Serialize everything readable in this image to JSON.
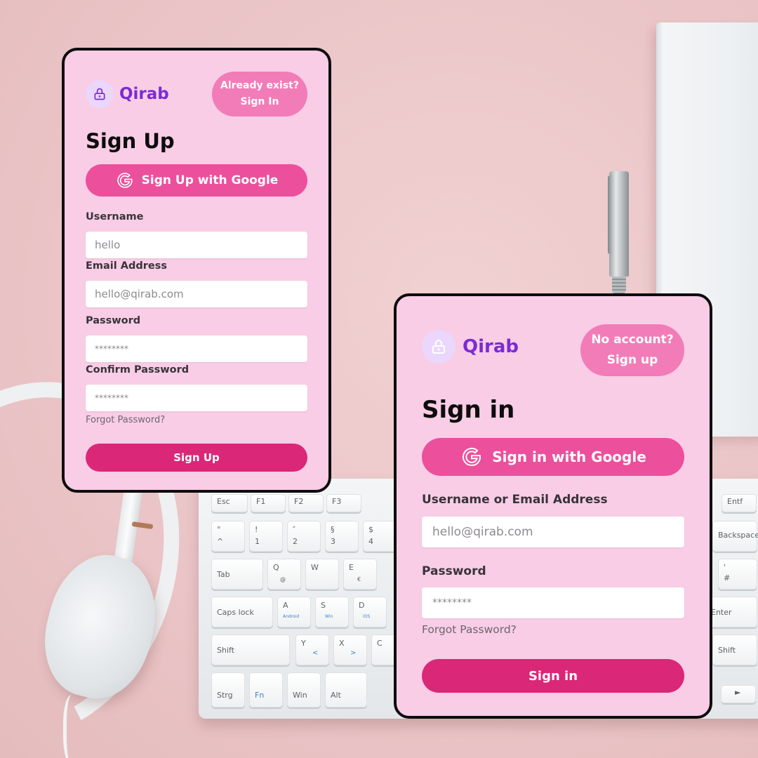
{
  "colors": {
    "card_bg": "#f9cde6",
    "brand_purple": "#7b2bd3",
    "pill_pink": "#f27cb8",
    "google_pink": "#ec4f9c",
    "submit_pink": "#db2777",
    "border": "#0d0d0d"
  },
  "background": {
    "keyboard_keys": {
      "esc": "Esc",
      "f1": "F1",
      "f2": "F2",
      "f3": "F3",
      "n0": "°",
      "n0b": "^",
      "n1": "!",
      "n1b": "1",
      "n2": "″",
      "n2b": "2",
      "n3": "§",
      "n3b": "3",
      "n4": "$",
      "n4b": "4",
      "tab": "Tab",
      "q": "Q",
      "q_sub": "@",
      "w": "W",
      "e": "E",
      "e_sub": "€",
      "caps": "Caps lock",
      "a": "A",
      "a_sub": "Android",
      "s": "S",
      "s_sub": "Win",
      "d": "D",
      "d_sub": "iOS",
      "shift_l": "Shift",
      "y": "Y",
      "y_sub": "<",
      "x": "X",
      "x_sub": ">",
      "c": "C",
      "strg": "Strg",
      "fn": "Fn",
      "win": "Win",
      "alt": "Alt",
      "entf": "Entf",
      "backspace": "Backspace",
      "hash": "'",
      "hash_b": "#",
      "enter": "Enter",
      "shift_r": "Shift",
      "right": "►"
    }
  },
  "signup": {
    "icon": "lock-icon",
    "brand": "Qirab",
    "top_pill": {
      "line1": "Already exist?",
      "line2": "Sign In"
    },
    "heading": "Sign Up",
    "google_button": "Sign Up with Google",
    "fields": {
      "username": {
        "label": "Username",
        "value": "hello"
      },
      "email": {
        "label": "Email Address",
        "placeholder": "hello@qirab.com"
      },
      "password": {
        "label": "Password",
        "placeholder": "********"
      },
      "confirm": {
        "label": "Confirm Password",
        "placeholder": "********"
      }
    },
    "forgot": "Forgot Password?",
    "submit": "Sign Up"
  },
  "signin": {
    "icon": "lock-icon",
    "brand": "Qirab",
    "top_pill": {
      "line1": "No account?",
      "line2": "Sign up"
    },
    "heading": "Sign in",
    "google_button": "Sign in with Google",
    "fields": {
      "user_email": {
        "label": "Username or Email Address",
        "placeholder": "hello@qirab.com"
      },
      "password": {
        "label": "Password",
        "placeholder": "********"
      }
    },
    "forgot": "Forgot Password?",
    "submit": "Sign in"
  }
}
